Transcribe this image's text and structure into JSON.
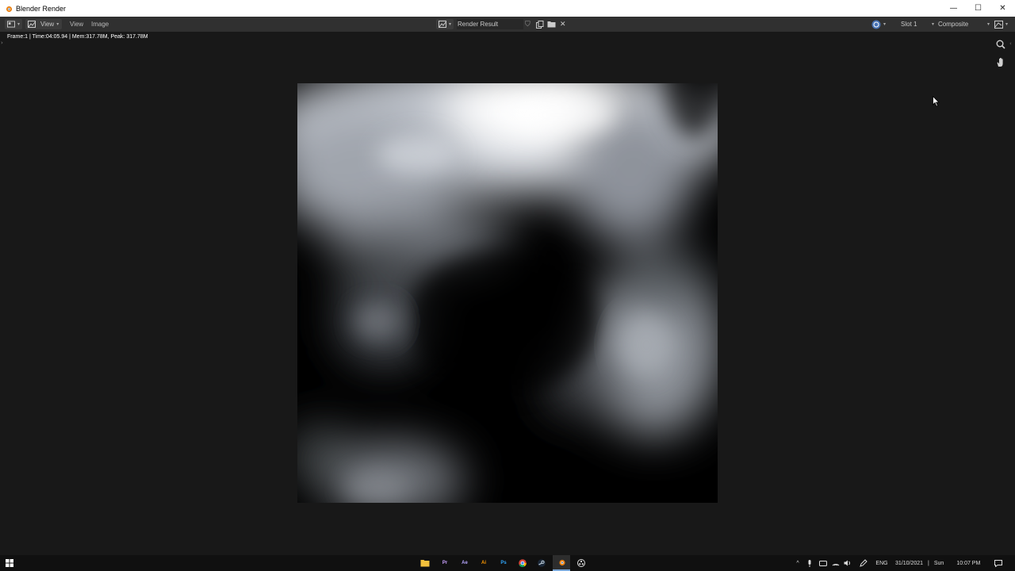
{
  "window": {
    "title": "Blender Render"
  },
  "header": {
    "view_label": "View",
    "menus": [
      "View",
      "Image"
    ],
    "image_name": "Render Result",
    "slot": "Slot 1",
    "layer": "Composite"
  },
  "info": "Frame:1 | Time:04:05.94 | Mem:317.78M, Peak: 317.78M",
  "taskbar": {
    "apps": [
      "Pr",
      "Ae",
      "Ai",
      "Ps"
    ],
    "language": "ENG",
    "date": "31/10/2021",
    "day": "Sun",
    "time": "10:07 PM"
  }
}
